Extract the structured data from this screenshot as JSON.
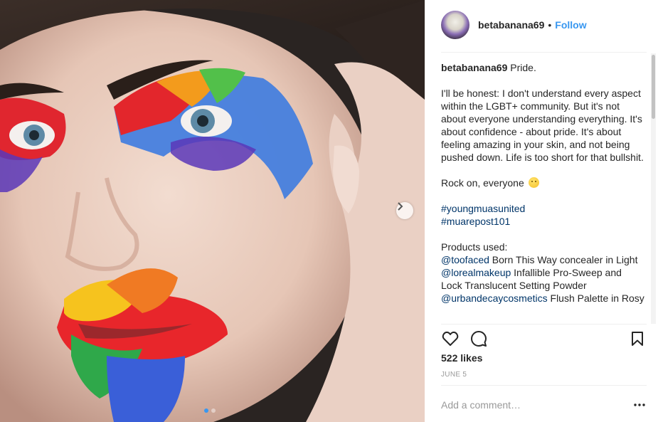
{
  "post": {
    "username": "betabanana69",
    "follow_label": "Follow",
    "separator": "•",
    "image_alt": "rainbow face paint portrait",
    "carousel": {
      "count": 2,
      "active_index": 0
    }
  },
  "caption": {
    "author": "betabanana69",
    "first_line": "Pride.",
    "body": "I'll be honest: I don't understand every aspect within the LGBT+ community. But it's not about everyone understanding everything. It's about confidence - about pride. It's about feeling amazing in your skin, and not being pushed down. Life is too short for that bullshit.",
    "rock_on": "Rock on, everyone",
    "hashtags": [
      "#youngmuasunited",
      "#muarepost101"
    ],
    "products_heading": "Products used:",
    "products": [
      {
        "mention": "@toofaced",
        "text": " Born This Way concealer in Light"
      },
      {
        "mention": "@lorealmakeup",
        "text": " Infallible Pro-Sweep and Lock Translucent Setting Powder"
      },
      {
        "mention": "@urbandecaycosmetics",
        "text": " Flush Palette in Rosy"
      }
    ]
  },
  "actions": {
    "like_icon": "heart-icon",
    "comment_icon": "comment-bubble-icon",
    "save_icon": "bookmark-icon"
  },
  "likes": "522 likes",
  "date": "JUNE 5",
  "comment": {
    "placeholder": "Add a comment…",
    "more_icon": "more-dots-icon"
  },
  "colors": {
    "link_blue": "#3897f0",
    "tag_blue": "#003569",
    "muted": "#999999",
    "text": "#262626"
  }
}
